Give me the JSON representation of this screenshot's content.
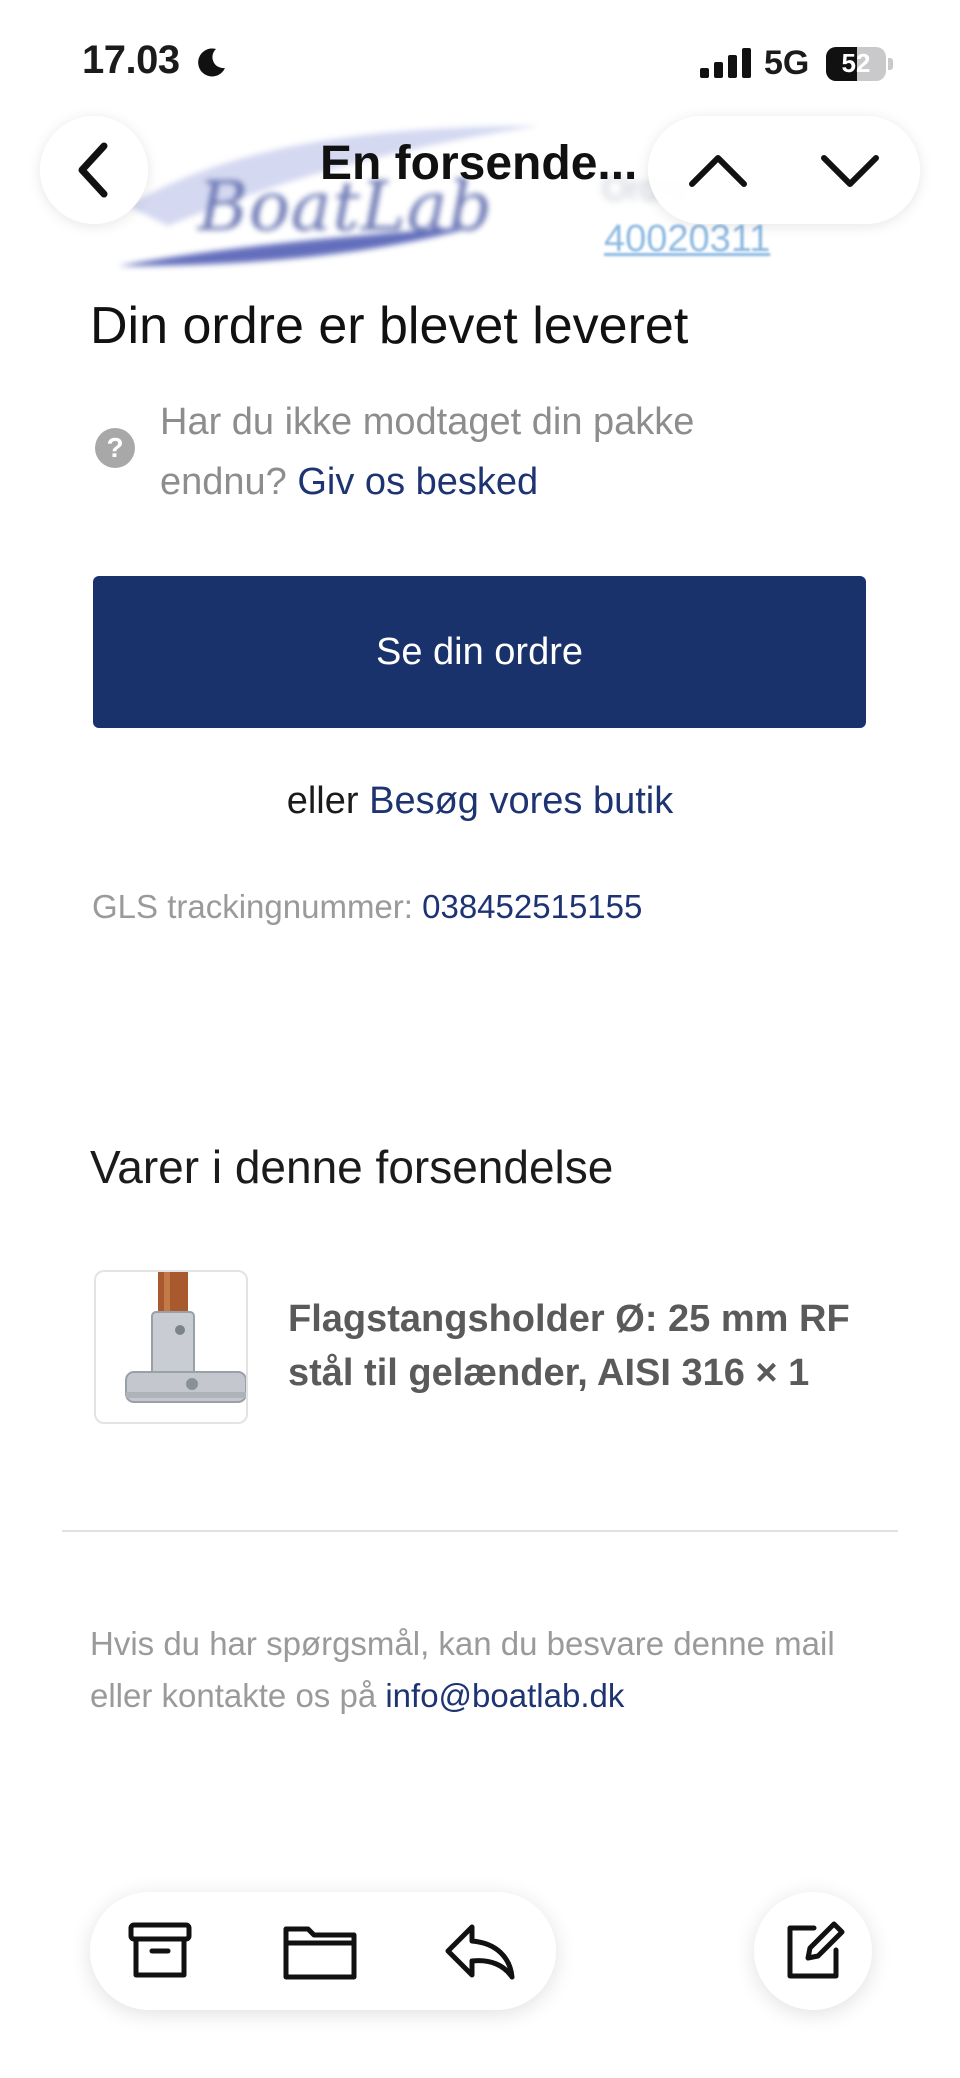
{
  "status_bar": {
    "time": "17.03",
    "network": "5G",
    "battery": "52"
  },
  "email_header": {
    "brand": "BoatLab",
    "order_label": "Ordre",
    "order_number": "40020311"
  },
  "nav": {
    "title": "En forsende..."
  },
  "email": {
    "headline": "Din ordre er blevet leveret",
    "help_icon_glyph": "?",
    "help_prefix": "Har du ikke modtaget din pakke endnu?",
    "help_link": "Giv os besked",
    "primary_button": "Se din ordre",
    "alt_prefix": "eller",
    "alt_link": "Besøg vores butik",
    "tracking_label": "GLS trackingnummer:",
    "tracking_number": "038452515155",
    "items_title": "Varer i denne forsendelse",
    "items": [
      {
        "title": "Flagstangsholder Ø: 25 mm RF stål til gelænder, AISI 316 × 1"
      }
    ],
    "footer_prefix": "Hvis du har spørgsmål, kan du besvare denne mail eller kontakte os på",
    "footer_link": "info@boatlab.dk"
  },
  "toolbar": {
    "icons": [
      "archive-icon",
      "folder-icon",
      "reply-icon",
      "compose-icon"
    ]
  },
  "colors": {
    "accent": "#1a326c",
    "link": "#1e3472",
    "muted": "#9a9a9a"
  }
}
